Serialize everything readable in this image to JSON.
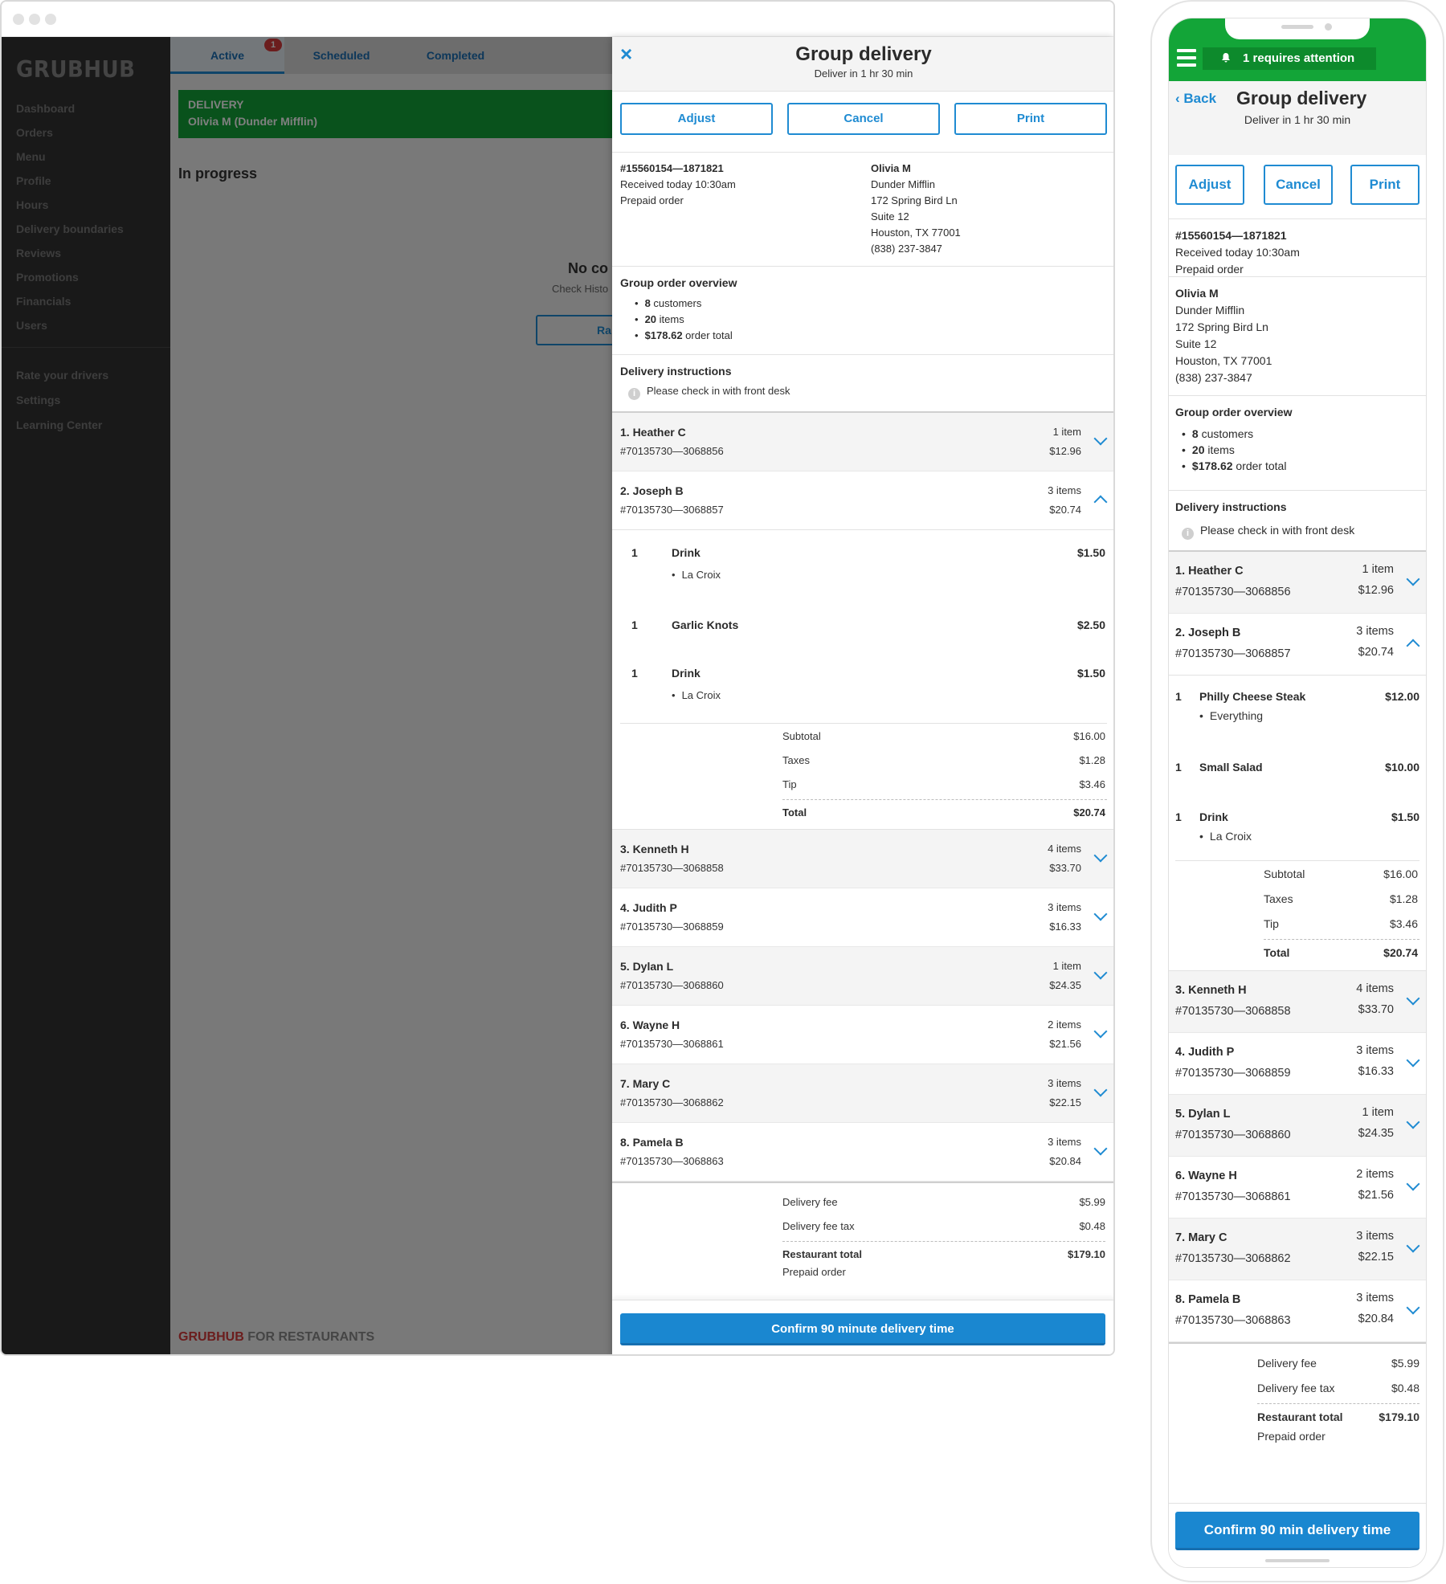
{
  "colors": {
    "brand_green": "#13a538",
    "accent_blue": "#1f8bd2",
    "sidebar": "#333333",
    "alert_red": "#d73b3b"
  },
  "desktop": {
    "sidebar": {
      "logo": "GRUBHUB",
      "nav": [
        "Dashboard",
        "Orders",
        "Menu",
        "Profile",
        "Hours",
        "Delivery boundaries",
        "Reviews",
        "Promotions",
        "Financials",
        "Users"
      ],
      "nav2": [
        "Rate your drivers",
        "Settings",
        "Learning Center"
      ]
    },
    "tabs": [
      {
        "label": "Active",
        "badge": "1"
      },
      {
        "label": "Scheduled"
      },
      {
        "label": "Completed"
      }
    ],
    "delivery_card": {
      "label": "DELIVERY",
      "customer": "Olivia M (Dunder Mifflin)"
    },
    "in_progress": "In progress",
    "empty": {
      "title": "No co",
      "subtitle": "Check Histo",
      "button": "Ra"
    },
    "footer": {
      "brand": "GRUBHUB",
      "rest": " FOR RESTAURANTS"
    },
    "panel": {
      "close_icon": "×",
      "title": "Group delivery",
      "subtitle": "Deliver in 1 hr 30 min",
      "actions": [
        "Adjust",
        "Cancel",
        "Print"
      ],
      "order": {
        "number": "#15560154—1871821",
        "received": "Received today 10:30am",
        "payment": "Prepaid order"
      },
      "customer": {
        "name": "Olivia M",
        "company": "Dunder Mifflin",
        "street": "172 Spring Bird Ln",
        "suite": "Suite 12",
        "city": "Houston, TX 77001",
        "phone": "(838) 237-3847"
      },
      "overview": {
        "title": "Group order overview",
        "customers_num": "8",
        "customers_lbl": " customers",
        "items_num": "20",
        "items_lbl": " items",
        "total_num": "$178.62",
        "total_lbl": " order total"
      },
      "instructions": {
        "title": "Delivery instructions",
        "text": "Please check in with front desk"
      },
      "customers": [
        {
          "name": "1.  Heather C",
          "order": "#70135730—3068856",
          "count": "1 item",
          "amount": "$12.96"
        },
        {
          "name": "2.  Joseph B",
          "order": "#70135730—3068857",
          "count": "3 items",
          "amount": "$20.74"
        },
        {
          "name": "3.  Kenneth H",
          "order": "#70135730—3068858",
          "count": "4 items",
          "amount": "$33.70"
        },
        {
          "name": "4.  Judith P",
          "order": "#70135730—3068859",
          "count": "3 items",
          "amount": "$16.33"
        },
        {
          "name": "5.  Dylan L",
          "order": "#70135730—3068860",
          "count": "1 item",
          "amount": "$24.35"
        },
        {
          "name": "6.  Wayne H",
          "order": "#70135730—3068861",
          "count": "2 items",
          "amount": "$21.56"
        },
        {
          "name": "7.  Mary C",
          "order": "#70135730—3068862",
          "count": "3 items",
          "amount": "$22.15"
        },
        {
          "name": "8.  Pamela B",
          "order": "#70135730—3068863",
          "count": "3 items",
          "amount": "$20.84"
        }
      ],
      "expanded_items": [
        {
          "qty": "1",
          "name": "Drink",
          "price": "$1.50",
          "option": "La Croix"
        },
        {
          "qty": "1",
          "name": "Garlic Knots",
          "price": "$2.50"
        },
        {
          "qty": "1",
          "name": "Drink",
          "price": "$1.50",
          "option": "La Croix"
        }
      ],
      "subtotals": {
        "subtotal_lbl": "Subtotal",
        "subtotal": "$16.00",
        "taxes_lbl": "Taxes",
        "taxes": "$1.28",
        "tip_lbl": "Tip",
        "tip": "$3.46",
        "total_lbl": "Total",
        "total": "$20.74"
      },
      "fees": {
        "fee_lbl": "Delivery fee",
        "fee": "$5.99",
        "tax_lbl": "Delivery fee tax",
        "tax": "$0.48",
        "total_lbl": "Restaurant total",
        "total": "$179.10",
        "prepaid": "Prepaid order"
      },
      "confirm": "Confirm 90 minute delivery time"
    }
  },
  "phone": {
    "attention": "1 requires attention",
    "back": "Back",
    "title": "Group delivery",
    "subtitle": "Deliver in 1 hr 30 min",
    "actions": [
      "Adjust",
      "Cancel",
      "Print"
    ],
    "expanded_items": [
      {
        "qty": "1",
        "name": "Philly Cheese Steak",
        "price": "$12.00",
        "option": "Everything"
      },
      {
        "qty": "1",
        "name": "Small Salad",
        "price": "$10.00"
      },
      {
        "qty": "1",
        "name": "Drink",
        "price": "$1.50",
        "option": "La Croix"
      }
    ],
    "confirm": "Confirm 90 min delivery time"
  }
}
